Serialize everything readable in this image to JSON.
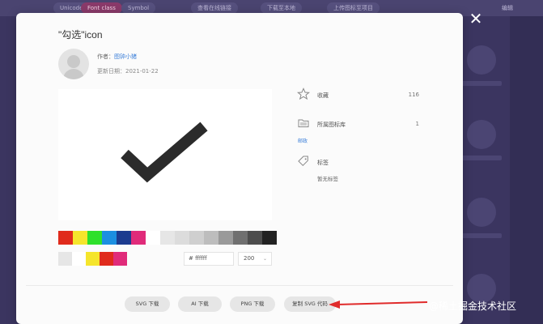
{
  "background": {
    "tabs": [
      "Unicode",
      "Font class",
      "Symbol",
      "查看在线链接",
      "下载至本地",
      "上传图标至项目"
    ],
    "right_edge_text": "编辑"
  },
  "modal": {
    "title": "\"勾选\"icon",
    "author_label": "作者：",
    "author_name": "图钟小猪",
    "updated_label": "更新日期：",
    "updated_date": "2021-01-22",
    "favorite_label": "收藏",
    "favorite_count": "116",
    "library_label": "所属图标库",
    "library_count": "1",
    "library_link": "邮政",
    "tags_label": "标签",
    "tags_value": "暂无标签",
    "color_input": "# ffffff",
    "size_select": "200",
    "buttons": {
      "svg_download": "SVG 下载",
      "ai_download": "AI 下载",
      "png_download": "PNG 下载",
      "copy_svg": "复制 SVG 代码"
    }
  },
  "colors": {
    "swatches_row1": [
      "#e02b1c",
      "#f5e52c",
      "#2ee02b",
      "#1c8fe0",
      "#1c3b8f",
      "#e02b7a",
      "#ffffff",
      "#e6e6e6",
      "#dcdcdc",
      "#cfcfcf",
      "#bdbdbd",
      "#9a9a9a",
      "#707070",
      "#4d4d4d",
      "#222222"
    ],
    "swatches_row2": [
      "#e6e6e6",
      "#ffffff",
      "#f5e52c",
      "#e02b1c",
      "#e02b7a"
    ],
    "check_color": "#2b2b2b",
    "arrow_color": "#e02b2b"
  },
  "watermark": "@稀土掘金技术社区"
}
